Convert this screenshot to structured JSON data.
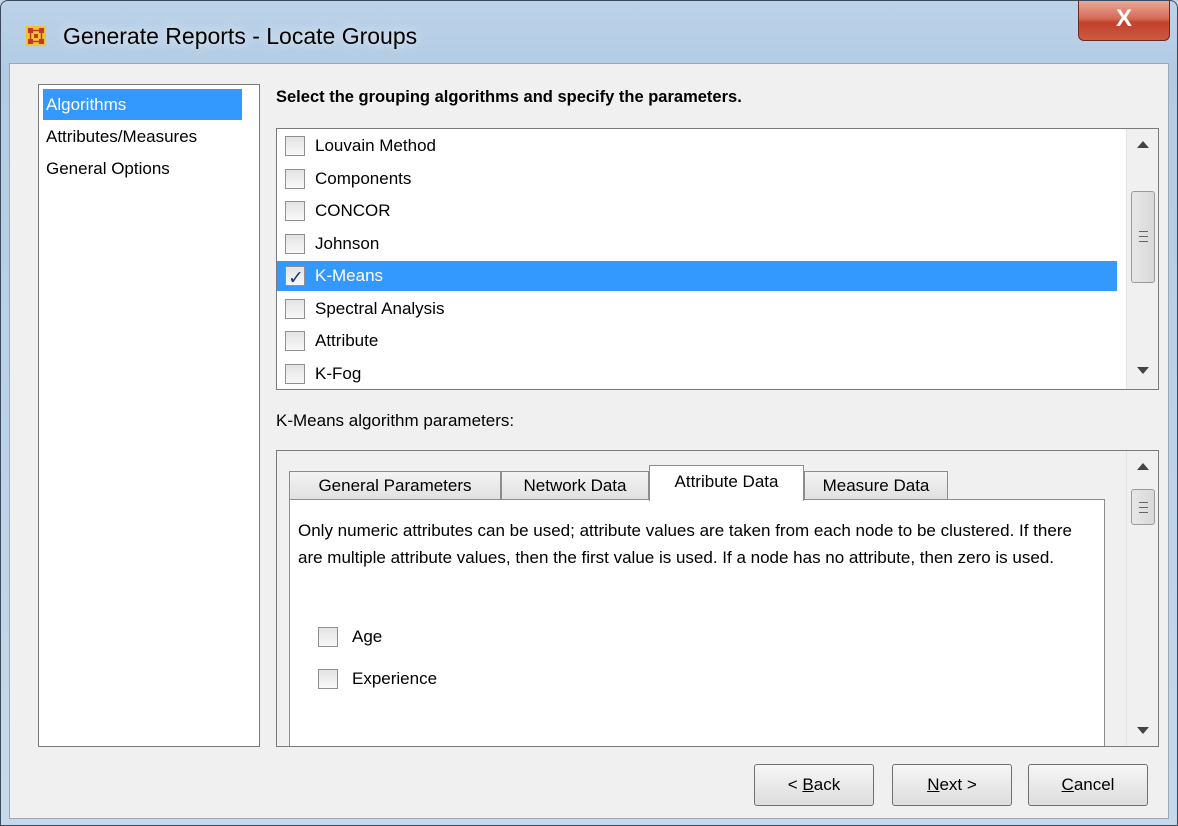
{
  "window": {
    "title": "Generate Reports - Locate Groups",
    "close_label": "X"
  },
  "nav": {
    "items": [
      {
        "label": "Algorithms",
        "selected": true
      },
      {
        "label": "Attributes/Measures",
        "selected": false
      },
      {
        "label": "General Options",
        "selected": false
      }
    ]
  },
  "algorithms": {
    "heading": "Select the grouping algorithms and specify the parameters.",
    "items": [
      {
        "label": "Louvain Method",
        "checked": false,
        "selected": false
      },
      {
        "label": "Components",
        "checked": false,
        "selected": false
      },
      {
        "label": "CONCOR",
        "checked": false,
        "selected": false
      },
      {
        "label": "Johnson",
        "checked": false,
        "selected": false
      },
      {
        "label": "K-Means",
        "checked": true,
        "selected": true
      },
      {
        "label": "Spectral Analysis",
        "checked": false,
        "selected": false
      },
      {
        "label": "Attribute",
        "checked": false,
        "selected": false
      },
      {
        "label": "K-Fog",
        "checked": false,
        "selected": false
      }
    ]
  },
  "params": {
    "label": "K-Means algorithm parameters:",
    "tabs": [
      {
        "label": "General Parameters",
        "active": false
      },
      {
        "label": "Network Data",
        "active": false
      },
      {
        "label": "Attribute Data",
        "active": true
      },
      {
        "label": "Measure Data",
        "active": false
      }
    ],
    "description": "Only numeric attributes can be used; attribute values are taken from each node to be clustered. If there are multiple attribute values, then the first value is used. If a node has no attribute, then zero is used.",
    "attributes": [
      {
        "label": "Age",
        "checked": false
      },
      {
        "label": "Experience",
        "checked": false
      }
    ]
  },
  "buttons": {
    "back": {
      "prefix": "< ",
      "mnemonic": "B",
      "rest": "ack"
    },
    "next": {
      "mnemonic": "N",
      "rest": "ext >"
    },
    "cancel": {
      "mnemonic": "C",
      "rest": "ancel"
    }
  },
  "colors": {
    "selection": "#3399ff",
    "title_bar": "#bcd3ea",
    "close_button": "#c2402a"
  },
  "icons": {
    "app": "network-grid-icon",
    "check": "checkmark-icon"
  }
}
